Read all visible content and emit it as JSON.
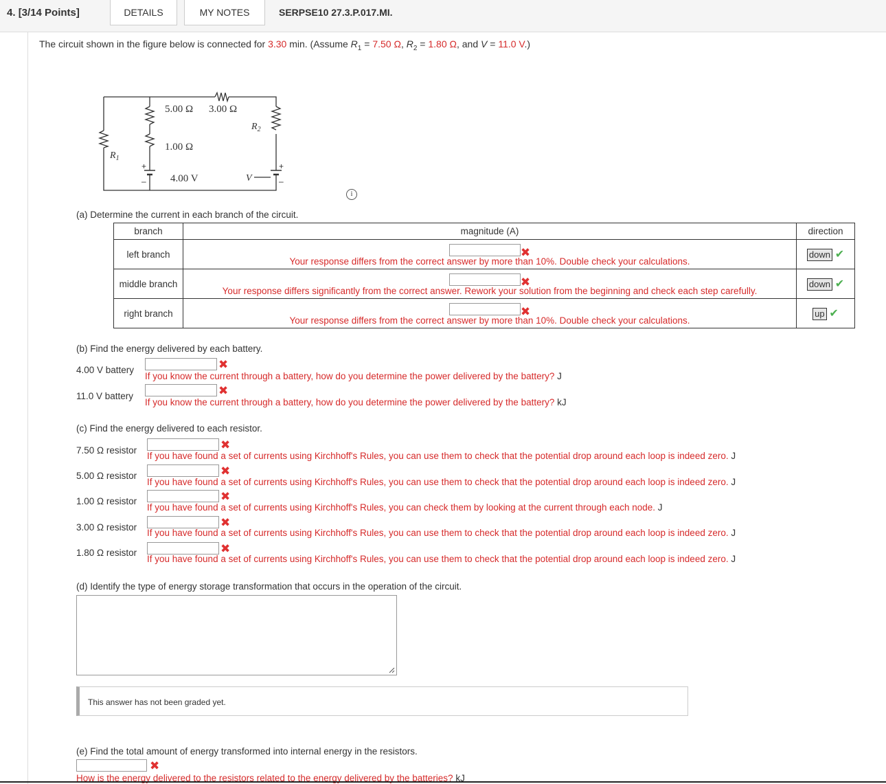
{
  "header": {
    "question_number": "4.",
    "points": "[3/14 Points]",
    "tab_details": "DETAILS",
    "tab_my_notes": "MY NOTES",
    "question_id": "SERPSE10 27.3.P.017.MI."
  },
  "prompt": {
    "p1": "The circuit shown in the figure below is connected for ",
    "time": "3.30",
    "p2": " min. (Assume ",
    "r1_label": "R",
    "r1_sub": "1",
    "p3": " = ",
    "r1": "7.50 Ω",
    "p4": ", ",
    "r2_label": "R",
    "r2_sub": "2",
    "p5": " = ",
    "r2": "1.80 Ω",
    "p6": ", and ",
    "v_label": "V",
    "p7": " = ",
    "v": "11.0 V",
    "p8": ".)"
  },
  "circuit": {
    "r5": "5.00 Ω",
    "r3": "3.00 Ω",
    "r1v": "1.00 Ω",
    "bat": "4.00 V",
    "lbl_R1": "R",
    "lbl_R1_sub": "1",
    "lbl_R2": "R",
    "lbl_R2_sub": "2",
    "lbl_V": "V",
    "plus": "+",
    "minus": "–"
  },
  "info_icon": "i",
  "part_a": {
    "question": "(a) Determine the current in each branch of the circuit.",
    "col_branch": "branch",
    "col_magnitude": "magnitude (A)",
    "col_direction": "direction",
    "rows": [
      {
        "branch": "left branch",
        "feedback": "Your response differs from the correct answer by more than 10%. Double check your calculations.",
        "direction": "down"
      },
      {
        "branch": "middle branch",
        "feedback": "Your response differs significantly from the correct answer. Rework your solution from the beginning and check each step carefully.",
        "direction": "down"
      },
      {
        "branch": "right branch",
        "feedback": "Your response differs from the correct answer by more than 10%. Double check your calculations.",
        "direction": "up"
      }
    ]
  },
  "part_b": {
    "question": "(b) Find the energy delivered by each battery.",
    "rows": [
      {
        "label": "4.00 V battery",
        "feedback": "If you know the current through a battery, how do you determine the power delivered by the battery?",
        "unit": "J"
      },
      {
        "label": "11.0 V battery",
        "feedback": "If you know the current through a battery, how do you determine the power delivered by the battery?",
        "unit": "kJ"
      }
    ]
  },
  "part_c": {
    "question": "(c) Find the energy delivered to each resistor.",
    "rows": [
      {
        "label": "7.50 Ω resistor",
        "feedback": "If you have found a set of currents using Kirchhoff's Rules, you can use them to check that the potential drop around each loop is indeed zero.",
        "unit": "J"
      },
      {
        "label": "5.00 Ω resistor",
        "feedback": "If you have found a set of currents using Kirchhoff's Rules, you can use them to check that the potential drop around each loop is indeed zero.",
        "unit": "J"
      },
      {
        "label": "1.00 Ω resistor",
        "feedback": "If you have found a set of currents using Kirchhoff's Rules, you can check them by looking at the current through each node.",
        "unit": "J"
      },
      {
        "label": "3.00 Ω resistor",
        "feedback": "If you have found a set of currents using Kirchhoff's Rules, you can use them to check that the potential drop around each loop is indeed zero.",
        "unit": "J"
      },
      {
        "label": "1.80 Ω resistor",
        "feedback": "If you have found a set of currents using Kirchhoff's Rules, you can use them to check that the potential drop around each loop is indeed zero.",
        "unit": "J"
      }
    ]
  },
  "part_d": {
    "question": "(d) Identify the type of energy storage transformation that occurs in the operation of the circuit.",
    "graded_note": "This answer has not been graded yet."
  },
  "part_e": {
    "question": "(e) Find the total amount of energy transformed into internal energy in the resistors.",
    "feedback": "How is the energy delivered to the resistors related to the energy delivered by the batteries?",
    "unit": "kJ"
  },
  "icons": {
    "wrong": "✖",
    "correct": "✔"
  }
}
